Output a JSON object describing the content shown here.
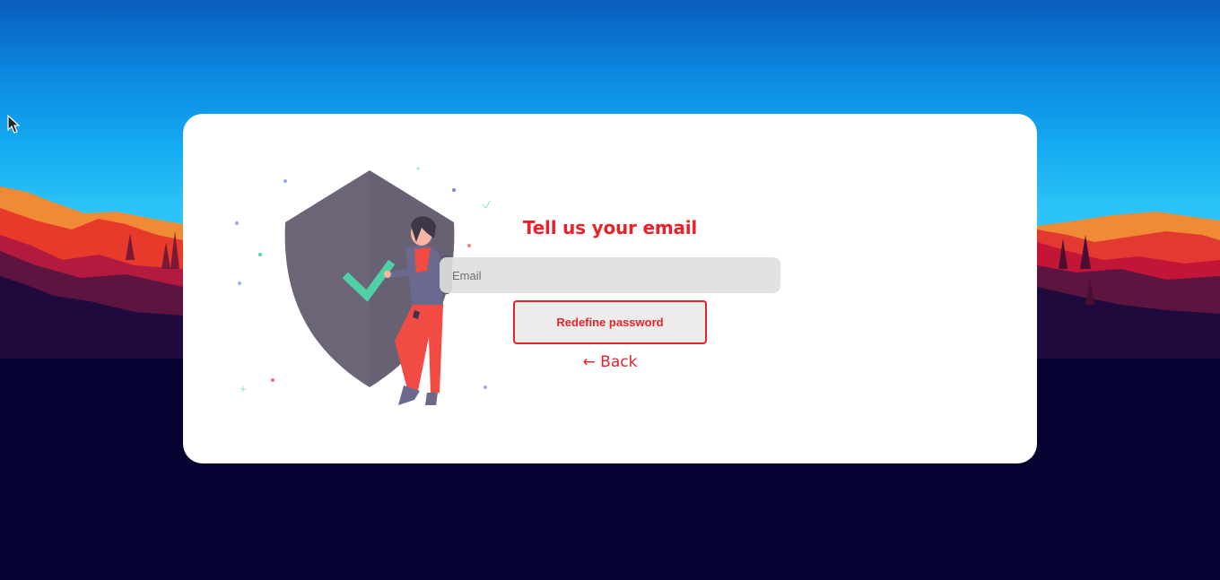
{
  "form": {
    "title": "Tell us your email",
    "email_placeholder": "Email",
    "email_value": "",
    "submit_label": "Redefine password",
    "back_label": "← Back"
  },
  "colors": {
    "accent": "#e8222a",
    "input_bg": "#dedede",
    "card_bg": "#ffffff",
    "shield": "#6b6577",
    "check": "#4fd1a5"
  },
  "icons": {
    "cursor": "mouse-pointer-icon",
    "shield": "shield-icon",
    "check": "checkmark-icon"
  }
}
